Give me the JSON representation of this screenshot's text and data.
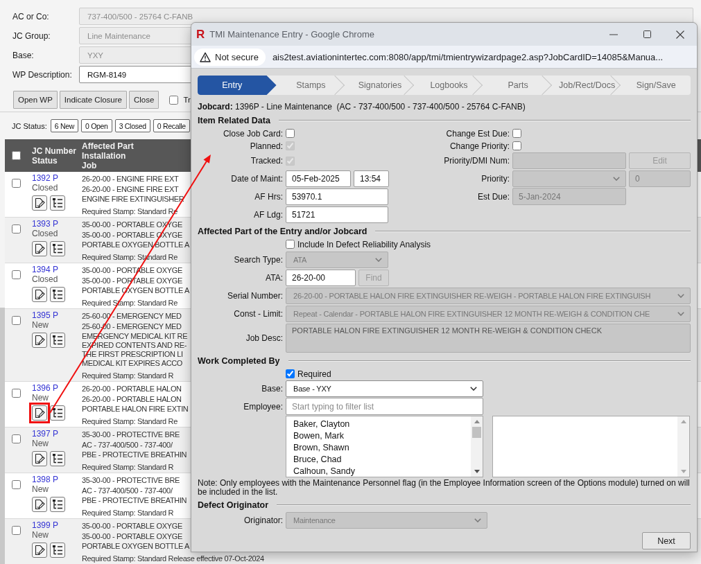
{
  "page": {
    "fields": [
      {
        "label": "AC or Co:",
        "value": "737-400/500 - 25764 C-FANB",
        "disabled": true
      },
      {
        "label": "JC Group:",
        "value": "Line Maintenance",
        "disabled": true
      },
      {
        "label": "Base:",
        "value": "YXY",
        "disabled": true
      },
      {
        "label": "WP Description:",
        "value": "RGM-8149",
        "disabled": false
      }
    ],
    "buttons": [
      "Open WP",
      "Indicate Closure",
      "Close"
    ],
    "option": {
      "label": "Tr",
      "checked": false
    },
    "status_label": "JC Status:",
    "status_chips": [
      "6 New",
      "0 Open",
      "3 Closed",
      "0 Recalle"
    ]
  },
  "table": {
    "select_all": false,
    "columns": [
      [
        "JC Number",
        "Status"
      ],
      [
        "Affected Part",
        "Installation",
        "Job"
      ]
    ],
    "rows": [
      {
        "number": "1392 P",
        "status": "Closed",
        "checked": false,
        "highlighted": false,
        "part": "26-20-00 - ENGINE FIRE EXT",
        "installation": "26-20-00 - ENGINE FIRE EXT",
        "job": [
          "ENGINE FIRE EXTINGUISHER"
        ],
        "stamp": "Required Stamp: Standard Re"
      },
      {
        "number": "1393 P",
        "status": "Closed",
        "checked": false,
        "highlighted": false,
        "part": "35-00-00 - PORTABLE OXYGE",
        "installation": "35-00-00 - PORTABLE OXYGE",
        "job": [
          "PORTABLE OXYGEN BOTTLE A"
        ],
        "stamp": "Required Stamp: Standard Re"
      },
      {
        "number": "1394 P",
        "status": "Closed",
        "checked": false,
        "highlighted": false,
        "part": "35-00-00 - PORTABLE OXYGE",
        "installation": "35-00-00 - PORTABLE OXYGE",
        "job": [
          "PORTABLE OXYGEN BOTTLE A"
        ],
        "stamp": "Required Stamp: Standard Re"
      },
      {
        "number": "1395 P",
        "status": "New",
        "checked": false,
        "highlighted": false,
        "part": "25-60-00 - EMERGENCY MED",
        "installation": "25-60-00 - EMERGENCY MED",
        "job": [
          "EMERGENCY MEDICAL KIT RE",
          "EXPIRED CONTENTS AND RE-",
          "THE FIRST PRESCRIPTION LI",
          "MEDICAL KIT EXPIRES ACCO"
        ],
        "stamp": "Required Stamp: Standard R"
      },
      {
        "number": "1396 P",
        "status": "New",
        "checked": false,
        "highlighted": true,
        "part": "26-20-00 - PORTABLE HALON",
        "installation": "26-20-00 - PORTABLE HALON",
        "job": [
          "PORTABLE HALON FIRE EXTIN"
        ],
        "stamp": "Required Stamp: Standard Re"
      },
      {
        "number": "1397 P",
        "status": "New",
        "checked": false,
        "highlighted": false,
        "part": "35-30-00 - PROTECTIVE BRE",
        "installation": "AC - 737-400/500 - 737-400/",
        "job": [
          "PBE - PROTECTIVE BREATHIN"
        ],
        "stamp": "Required Stamp: Standard R"
      },
      {
        "number": "1398 P",
        "status": "New",
        "checked": false,
        "highlighted": false,
        "part": "35-30-00 - PROTECTIVE BRE",
        "installation": "AC - 737-400/500 - 737-400/",
        "job": [
          "PBE - PROTECTIVE BREATHIN"
        ],
        "stamp": "Required Stamp: Standard R"
      },
      {
        "number": "1399 P",
        "status": "New",
        "checked": false,
        "highlighted": false,
        "part": "35-00-00 - PORTABLE OXYGE",
        "installation": "35-00-00 - PORTABLE OXYGE",
        "job": [
          "PORTABLE OXYGEN BOTTLE A"
        ],
        "stamp": "Required Stamp: Standard Release effective 07-Oct-2024"
      }
    ]
  },
  "dialog": {
    "logo": "R",
    "window_title": "TMI Maintenance Entry - Google Chrome",
    "security_label": "Not secure",
    "url": "ais2test.aviationintertec.com:8080/app/tmi/tmientrywizardpage2.asp?JobCardID=14085&Manua...",
    "steps": [
      {
        "label": "Entry",
        "selected": true
      },
      {
        "label": "Stamps",
        "selected": false
      },
      {
        "label": "Signatories",
        "selected": false
      },
      {
        "label": "Logbooks",
        "selected": false
      },
      {
        "label": "Parts",
        "selected": false
      },
      {
        "label": "Job/Rect/Docs",
        "selected": false
      },
      {
        "label": "Sign/Save",
        "selected": false
      }
    ],
    "jobcard": "**Jobcard:** 1396P - Line Maintenance  (AC - 737-400/500 - 737-400/500 - 25764 C-FANB)",
    "item_data": {
      "title": "Item Related Data",
      "left": [
        {
          "kind": "checkbox",
          "label": "Close Job Card:",
          "checked": false,
          "disabled": false
        },
        {
          "kind": "checkbox",
          "label": "Planned:",
          "checked": true,
          "disabled": true
        },
        {
          "kind": "checkbox",
          "label": "Tracked:",
          "checked": true,
          "disabled": true
        },
        {
          "kind": "date",
          "label": "Date of Maint:",
          "date": "05-Feb-2025",
          "time": "13:54"
        },
        {
          "kind": "text",
          "label": "AF Hrs:",
          "value": "53970.1",
          "disabled": false
        },
        {
          "kind": "text",
          "label": "AF Ldg:",
          "value": "51721",
          "disabled": false
        }
      ],
      "right": [
        {
          "kind": "checkbox",
          "label": "Change Est Due:",
          "checked": false,
          "disabled": false
        },
        {
          "kind": "checkbox",
          "label": "Change Priority:",
          "checked": false,
          "disabled": false
        },
        {
          "kind": "text_button",
          "label": "Priority/DMI Num:",
          "disabled": true,
          "button": {
            "label": "Edit",
            "disabled": true
          }
        },
        {
          "kind": "select_text",
          "label": "Priority:",
          "disabled": true,
          "extra": "0"
        },
        {
          "kind": "text",
          "label": "Est Due:",
          "value": "5-Jan-2024",
          "disabled": true
        }
      ]
    },
    "affected_part": {
      "title": "Affected Part of the Entry and/or Jobcard",
      "fields": [
        {
          "kind": "check_option",
          "label": "Include In Defect Reliability Analysis",
          "checked": false
        },
        {
          "kind": "select",
          "label": "Search Type:",
          "value": "ATA",
          "disabled": true
        },
        {
          "kind": "text_button",
          "label": "ATA:",
          "value": "26-20-00",
          "disabled": false,
          "button": {
            "label": "Find",
            "disabled": true
          }
        },
        {
          "kind": "wide_select",
          "label": "Serial Number:",
          "value": "26-20-00 - PORTABLE HALON FIRE EXTINGUISHER RE-WEIGH - PORTABLE HALON FIRE EXTINGUISH",
          "disabled": true
        },
        {
          "kind": "wide_select",
          "label": "Const - Limit:",
          "value": "Repeat - Calendar - PORTABLE HALON FIRE EXTINGUISHER 12 MONTH RE-WEIGH & CONDITION CHE",
          "disabled": true
        },
        {
          "kind": "textarea",
          "label": "Job Desc:",
          "value": "PORTABLE HALON FIRE EXTINGUISHER 12 MONTH RE-WEIGH & CONDITION CHECK",
          "disabled": true
        }
      ]
    },
    "work_completed": {
      "title": "Work Completed By",
      "fields": [
        {
          "kind": "check_option",
          "label": "Required",
          "checked": true
        },
        {
          "kind": "select",
          "label": "Base:",
          "value": "Base - YXY",
          "disabled": false
        },
        {
          "kind": "text",
          "label": "Employee:",
          "placeholder": "Start typing to filter list",
          "disabled": false
        }
      ],
      "employees": [
        {
          "name": "Baker, Clayton",
          "selected": false
        },
        {
          "name": "Bowen, Mark",
          "selected": false
        },
        {
          "name": "Brown, Shawn",
          "selected": false
        },
        {
          "name": "Bruce, Chad",
          "selected": false
        },
        {
          "name": "Calhoun, Sandy",
          "selected": false
        }
      ]
    },
    "note": "Note: Only employees with the Maintenance Personnel flag (in the Employee Information screen of the Options module) turned on will be included in the list.",
    "defect_originator": {
      "title": "Defect Originator",
      "fields": [
        {
          "kind": "select",
          "label": "Originator:",
          "value": "Maintenance",
          "disabled": true
        }
      ]
    },
    "next_button": "Next"
  }
}
